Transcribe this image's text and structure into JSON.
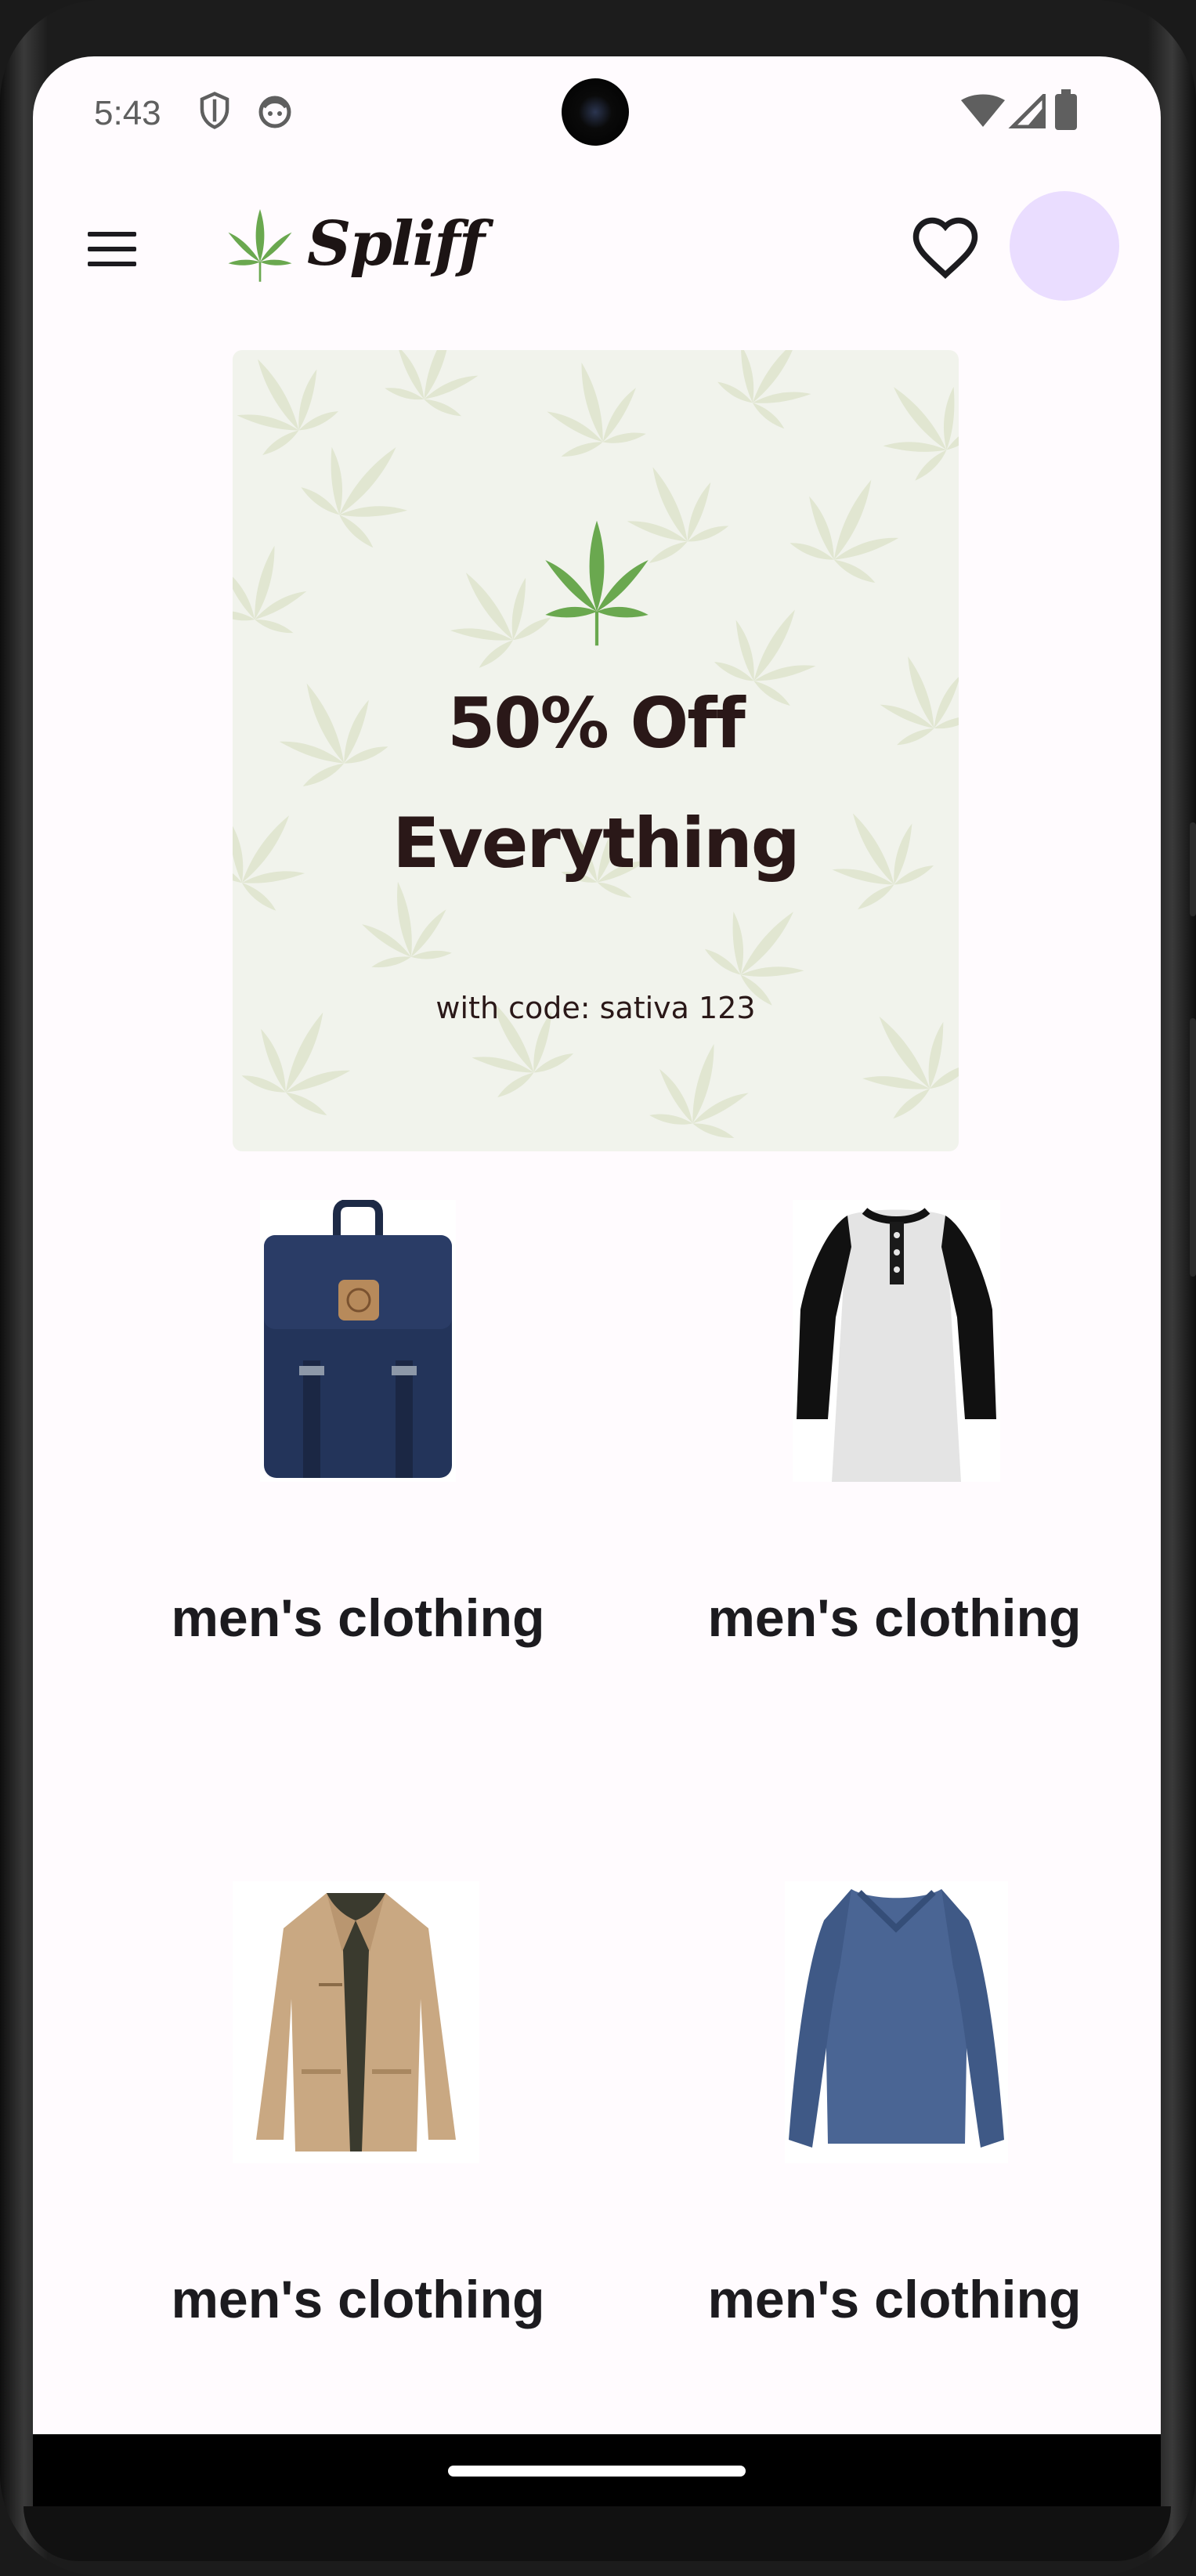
{
  "status_bar": {
    "time": "5:43",
    "left_icons": [
      "shield-icon",
      "notification-face-icon"
    ],
    "right_icons": [
      "wifi-icon",
      "signal-icon",
      "battery-icon"
    ]
  },
  "app_bar": {
    "menu_icon": "menu-icon",
    "logo_text": "Spliff",
    "favorites_icon": "heart-icon",
    "avatar_color": "#eaddff"
  },
  "banner": {
    "title_line1": "50% Off",
    "title_line2": "Everything",
    "subtitle": "with code: sativa 123",
    "background": "#f1f3ec",
    "leaf_color": "#6aa84f"
  },
  "products": [
    {
      "category": "men's clothing",
      "image": "backpack"
    },
    {
      "category": "men's clothing",
      "image": "raglan-henley-shirt"
    },
    {
      "category": "men's clothing",
      "image": "khaki-jacket"
    },
    {
      "category": "men's clothing",
      "image": "blue-long-sleeve-tee"
    }
  ]
}
